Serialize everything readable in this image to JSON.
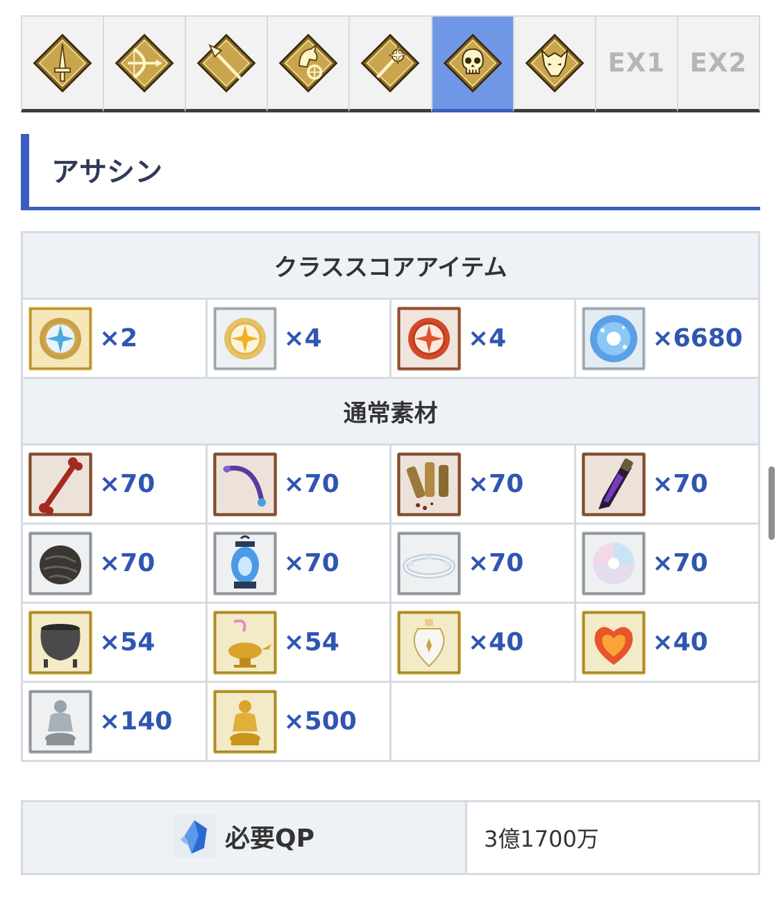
{
  "tabs": [
    {
      "id": "saber",
      "icon": "saber-class-icon",
      "active": false
    },
    {
      "id": "archer",
      "icon": "archer-class-icon",
      "active": false
    },
    {
      "id": "lancer",
      "icon": "lancer-class-icon",
      "active": false
    },
    {
      "id": "rider",
      "icon": "rider-class-icon",
      "active": false
    },
    {
      "id": "caster",
      "icon": "caster-class-icon",
      "active": false
    },
    {
      "id": "assassin",
      "icon": "assassin-class-icon",
      "active": true
    },
    {
      "id": "berserker",
      "icon": "berserker-class-icon",
      "active": false
    },
    {
      "id": "ex1",
      "label": "EX1",
      "active": false
    },
    {
      "id": "ex2",
      "label": "EX2",
      "active": false
    }
  ],
  "section_title": "アサシン",
  "class_score": {
    "header": "クラススコアアイテム",
    "items": [
      {
        "icon": "gold-star-compass-icon",
        "qty": "×2"
      },
      {
        "icon": "silver-star-compass-icon",
        "qty": "×4"
      },
      {
        "icon": "red-star-compass-icon",
        "qty": "×4"
      },
      {
        "icon": "blue-sparkle-orb-icon",
        "qty": "×6680"
      }
    ]
  },
  "normal": {
    "header": "通常素材",
    "rows": [
      [
        {
          "icon": "bone-icon",
          "qty": "×70"
        },
        {
          "icon": "purple-fang-icon",
          "qty": "×70"
        },
        {
          "icon": "shell-casings-icon",
          "qty": "×70"
        },
        {
          "icon": "dark-dagger-icon",
          "qty": "×70"
        }
      ],
      [
        {
          "icon": "dark-seed-icon",
          "qty": "×70"
        },
        {
          "icon": "blue-lantern-icon",
          "qty": "×70"
        },
        {
          "icon": "silver-crown-icon",
          "qty": "×70"
        },
        {
          "icon": "pearl-orb-icon",
          "qty": "×70"
        }
      ],
      [
        {
          "icon": "cauldron-icon",
          "qty": "×54"
        },
        {
          "icon": "magic-lamp-icon",
          "qty": "×54"
        },
        {
          "icon": "white-vase-icon",
          "qty": "×40"
        },
        {
          "icon": "fire-heart-icon",
          "qty": "×40"
        }
      ],
      [
        {
          "icon": "silver-assassin-statue-icon",
          "qty": "×140"
        },
        {
          "icon": "gold-assassin-statue-icon",
          "qty": "×500"
        }
      ]
    ]
  },
  "qp": {
    "icon": "qp-crystal-icon",
    "label": "必要QP",
    "value": "3億1700万"
  },
  "colors": {
    "accent": "#3a5cc0",
    "active_tab": "#6f97e6",
    "qty_text": "#2f56b0",
    "header_bg": "#eef2f7"
  }
}
